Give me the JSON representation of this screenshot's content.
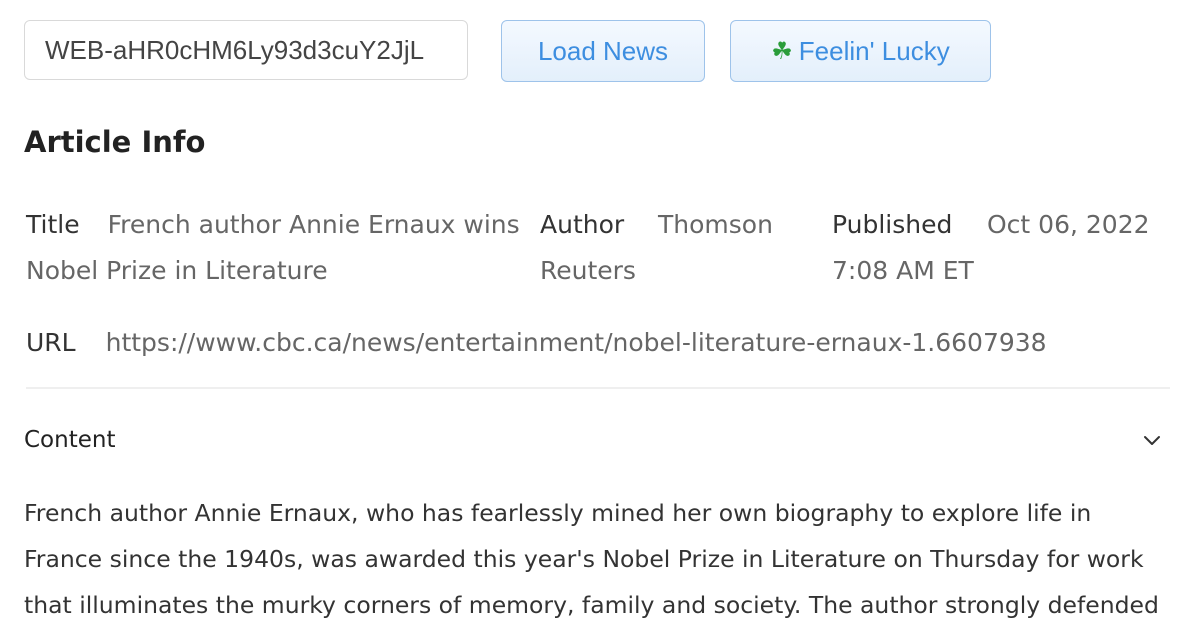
{
  "toolbar": {
    "news_id_value": "WEB-aHR0cHM6Ly93d3cuY2JjL",
    "load_label": "Load News",
    "lucky_label": "Feelin' Lucky"
  },
  "article": {
    "section_title": "Article Info",
    "title_label": "Title",
    "title_value": "French author Annie Ernaux wins Nobel Prize in Literature",
    "author_label": "Author",
    "author_line1": "Thomson",
    "author_line2": "Reuters",
    "published_label": "Published",
    "published_line1": "Oct 06, 2022",
    "published_line2": "7:08 AM ET",
    "url_label": "URL",
    "url_value": "https://www.cbc.ca/news/entertainment/nobel-literature-ernaux-1.6607938"
  },
  "content": {
    "label": "Content",
    "text": "French author Annie Ernaux, who has fearlessly mined her own biography to explore life in France since the 1940s, was awarded this year's Nobel Prize in Literature on Thursday for work that illuminates the murky corners of memory, family and society. The author strongly defended"
  },
  "icons": {
    "lucky": "clover-icon",
    "collapse": "chevron-down-icon"
  },
  "colors": {
    "accent": "#3d8ee0",
    "button_bg": "#e8f2fc",
    "button_border": "#9ec3ea"
  }
}
